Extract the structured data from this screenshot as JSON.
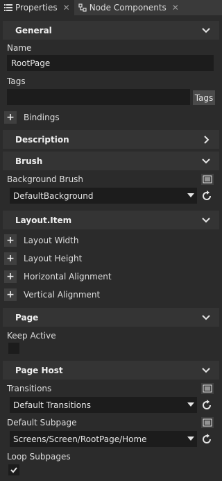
{
  "tabs": [
    {
      "label": "Properties",
      "active": true
    },
    {
      "label": "Node Components",
      "active": false
    }
  ],
  "sections": {
    "general": "General",
    "description": "Description",
    "brush": "Brush",
    "layout_item": "Layout.Item",
    "page": "Page",
    "page_host": "Page Host"
  },
  "general": {
    "name_label": "Name",
    "name_value": "RootPage",
    "tags_label": "Tags",
    "tags_value": "",
    "tags_button": "Tags",
    "bindings_label": "Bindings"
  },
  "brush": {
    "background_label": "Background Brush",
    "background_value": "DefaultBackground"
  },
  "layout_item": {
    "rows": [
      "Layout Width",
      "Layout Height",
      "Horizontal Alignment",
      "Vertical Alignment"
    ]
  },
  "page": {
    "keep_active_label": "Keep Active",
    "keep_active_checked": false
  },
  "page_host": {
    "transitions_label": "Transitions",
    "transitions_value": "Default Transitions",
    "default_subpage_label": "Default Subpage",
    "default_subpage_value": "Screens/Screen/RootPage/Home",
    "loop_subpages_label": "Loop Subpages",
    "loop_subpages_checked": true
  },
  "colors": {
    "background": "#2b2b2b",
    "section": "#343434",
    "field": "#1c1c1c",
    "tabbar": "#3a3a3a"
  }
}
